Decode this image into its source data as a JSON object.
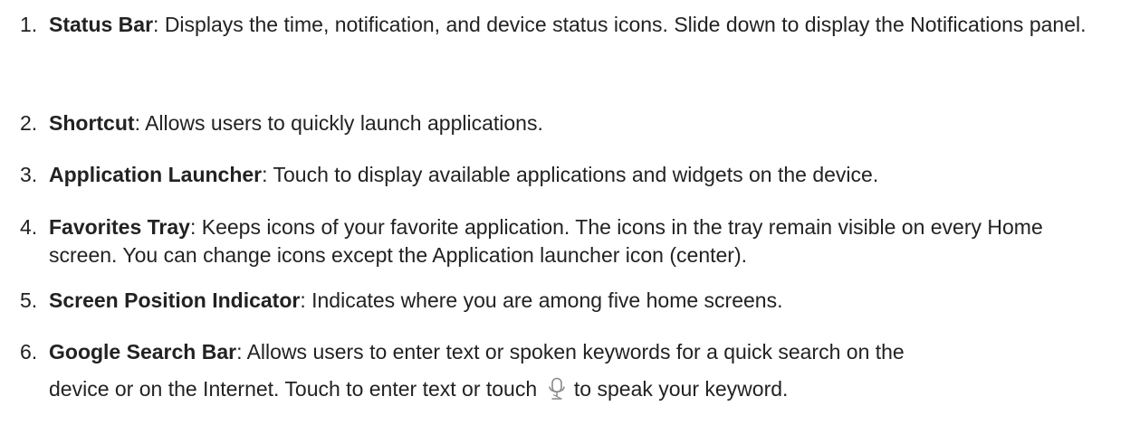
{
  "items": [
    {
      "number": "1.",
      "term": "Status Bar",
      "description": ": Displays the time, notification, and device status icons. Slide down to display the Notifications panel."
    },
    {
      "number": "2.",
      "term": "Shortcut",
      "description": ": Allows users to quickly launch applications."
    },
    {
      "number": "3.",
      "term": "Application Launcher",
      "description": ": Touch to display available applications and widgets on the device."
    },
    {
      "number": "4.",
      "term": "Favorites Tray",
      "description": ": Keeps icons of your favorite application. The icons in the tray remain visible on every Home screen. You can change icons except the Application launcher icon (center)."
    },
    {
      "number": "5.",
      "term": "Screen Position Indicator",
      "description": ": Indicates where you are among five home screens."
    },
    {
      "number": "6.",
      "term": "Google Search Bar",
      "description_line1": ": Allows users to enter text or spoken keywords for a quick search on the",
      "description_line2_before_icon": "device or on the Internet. Touch to enter text or touch",
      "icon": "microphone-icon",
      "description_line2_after_icon": " to speak your keyword."
    }
  ]
}
